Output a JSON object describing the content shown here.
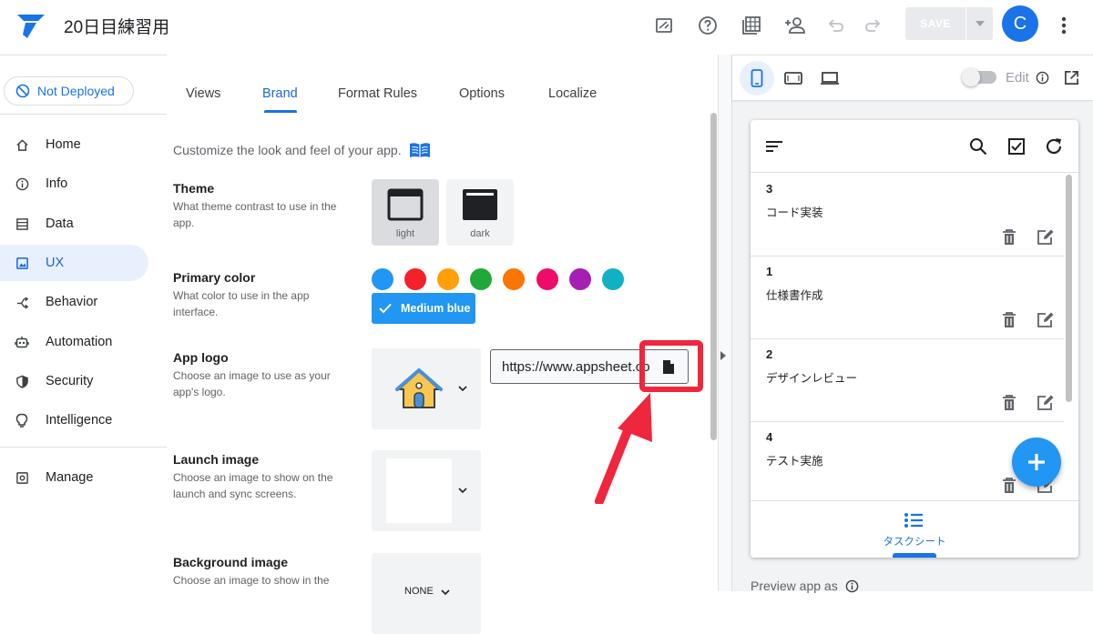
{
  "app": {
    "title": "20日目練習用"
  },
  "topbar": {
    "save_label": "SAVE",
    "avatar_initial": "C",
    "icons": [
      "editor-mode-icon",
      "help-icon",
      "table-icon",
      "share-user-icon",
      "undo-icon",
      "redo-icon"
    ]
  },
  "sidebar": {
    "deploy_status": "Not Deployed",
    "items": [
      {
        "label": "Home",
        "icon": "home-icon"
      },
      {
        "label": "Info",
        "icon": "info-icon"
      },
      {
        "label": "Data",
        "icon": "data-icon"
      },
      {
        "label": "UX",
        "icon": "ux-icon",
        "active": true
      },
      {
        "label": "Behavior",
        "icon": "behavior-icon"
      },
      {
        "label": "Automation",
        "icon": "automation-icon"
      },
      {
        "label": "Security",
        "icon": "security-icon"
      },
      {
        "label": "Intelligence",
        "icon": "intelligence-icon"
      }
    ],
    "manage": {
      "label": "Manage",
      "icon": "manage-icon"
    }
  },
  "tabs": [
    {
      "label": "Views"
    },
    {
      "label": "Brand",
      "active": true
    },
    {
      "label": "Format Rules"
    },
    {
      "label": "Options"
    },
    {
      "label": "Localize"
    }
  ],
  "brand": {
    "intro": "Customize the look and feel of your app.",
    "theme": {
      "title": "Theme",
      "desc": "What theme contrast to use in the app.",
      "options": [
        {
          "label": "light",
          "selected": true
        },
        {
          "label": "dark",
          "selected": false
        }
      ]
    },
    "primary_color": {
      "title": "Primary color",
      "desc": "What color to use in the app interface.",
      "swatches": [
        "#2196f3",
        "#f4202a",
        "#ff9f0a",
        "#20a938",
        "#fb7505",
        "#ee0b6a",
        "#a51fb4",
        "#11b0c4"
      ],
      "selected_label": "Medium blue"
    },
    "app_logo": {
      "title": "App logo",
      "desc": "Choose an image to use as your app's logo.",
      "url_value": "https://www.appsheet.com"
    },
    "launch_image": {
      "title": "Launch image",
      "desc": "Choose an image to show on the launch and sync screens."
    },
    "background_image": {
      "title": "Background image",
      "desc": "Choose an image to show in the",
      "value": "NONE"
    }
  },
  "preview": {
    "edit_label": "Edit",
    "tasks": [
      {
        "num": "3",
        "text": "コード実装"
      },
      {
        "num": "1",
        "text": "仕様書作成"
      },
      {
        "num": "2",
        "text": "デザインレビュー"
      },
      {
        "num": "4",
        "text": "テスト実施"
      }
    ],
    "bottom_nav_label": "タスクシート",
    "preview_as": "Preview app as"
  }
}
